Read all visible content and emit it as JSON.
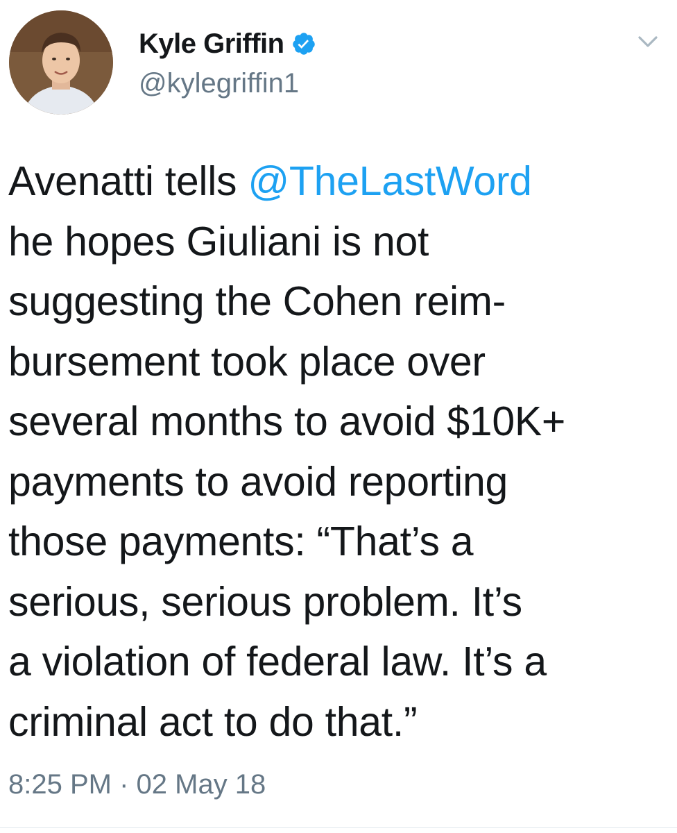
{
  "author": {
    "name": "Kyle Griffin",
    "handle": "@kylegriffin1",
    "verified": true,
    "verified_color": "#1da1f2"
  },
  "tweet": {
    "text_lines": [
      {
        "prefix": "Avenatti tells ",
        "mention": "@TheLastWord"
      },
      {
        "text": "he hopes Giuliani is not"
      },
      {
        "text": "suggesting the Cohen reim-"
      },
      {
        "text": "bursement took place over"
      },
      {
        "text": "several months to avoid $10K+"
      },
      {
        "text": "payments to avoid reporting"
      },
      {
        "text": "those payments: “That’s a"
      },
      {
        "text": "serious, serious problem. It’s"
      },
      {
        "text": "a violation of federal law. It’s a"
      },
      {
        "text": "criminal act to do that.”"
      }
    ],
    "time": "8:25 PM",
    "separator": " · ",
    "date": "02 May 18"
  },
  "icons": {
    "avatar": "avatar-photo",
    "verified": "verified-badge-icon",
    "menu": "chevron-down-icon"
  },
  "colors": {
    "text": "#14171a",
    "secondary": "#657786",
    "link": "#1da1f2"
  }
}
